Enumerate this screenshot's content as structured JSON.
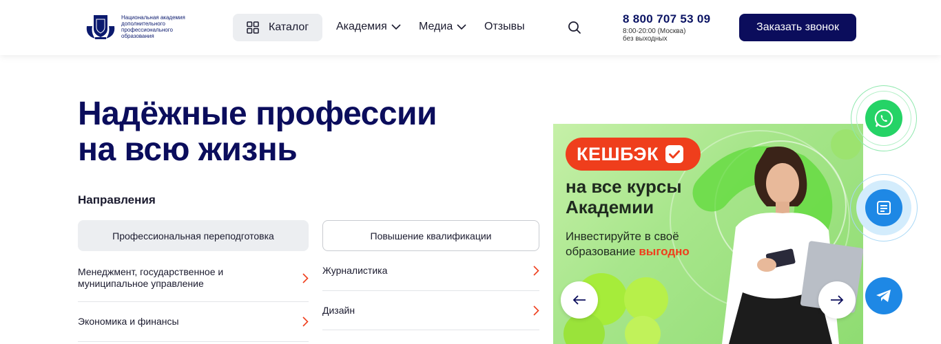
{
  "header": {
    "logo_text": "Национальная академия дополнительного профессионального образования",
    "catalog_label": "Каталог",
    "nav": [
      {
        "label": "Академия"
      },
      {
        "label": "Медиа"
      },
      {
        "label": "Отзывы"
      }
    ],
    "phone": "8 800 707 53 09",
    "hours": "8:00-20:00 (Москва)",
    "days": "без выходных",
    "call_button": "Заказать звонок"
  },
  "hero": {
    "title_line1": "Надёжные профессии",
    "title_line2": "на всю жизнь"
  },
  "directions": {
    "label": "Направления",
    "tabs": [
      {
        "label": "Профессиональная переподготовка"
      },
      {
        "label": "Повышение квалификации"
      }
    ],
    "left_items": [
      {
        "label": "Менеджмент, государственное и муниципальное управление"
      },
      {
        "label": "Экономика и финансы"
      }
    ],
    "right_items": [
      {
        "label": "Журналистика"
      },
      {
        "label": "Дизайн"
      }
    ]
  },
  "banner": {
    "pill": "КЕШБЭК",
    "head_line1": "на все курсы",
    "head_line2": "Академии",
    "sub_line1": "Инвестируйте в своё",
    "sub_line2_prefix": "образование",
    "sub_accent": "выгодно"
  },
  "colors": {
    "brand_navy": "#0b0d5c",
    "accent_orange": "#ef3e1c",
    "whatsapp": "#25d366",
    "feedback": "#1e88e5",
    "telegram": "#1e88e5"
  }
}
